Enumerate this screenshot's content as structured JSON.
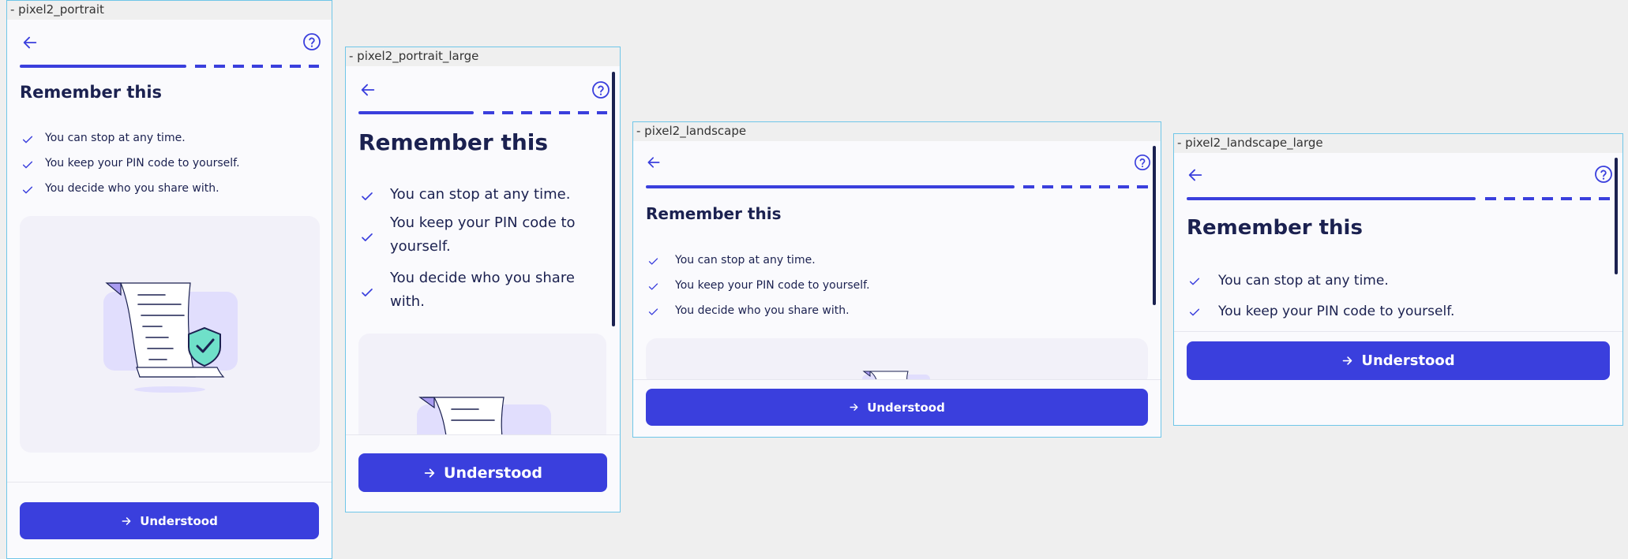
{
  "frames": [
    {
      "label": "- pixel2_portrait"
    },
    {
      "label": "- pixel2_portrait_large"
    },
    {
      "label": "- pixel2_landscape"
    },
    {
      "label": "- pixel2_landscape_large"
    }
  ],
  "screen": {
    "title": "Remember this",
    "items": [
      {
        "text": "You can stop at any time."
      },
      {
        "text": "You keep your PIN code to yourself."
      },
      {
        "text": "You decide who you share with."
      }
    ],
    "button_label": "Understood",
    "icons": {
      "back": "arrow-left-icon",
      "help": "question-circle-icon",
      "check": "checkmark-icon",
      "button": "arrow-right-icon"
    }
  },
  "colors": {
    "primary": "#3a3fdd",
    "text": "#1b2150",
    "background": "#fafafd",
    "card": "#f2f1f9",
    "frame_border": "#6fc6e8"
  }
}
